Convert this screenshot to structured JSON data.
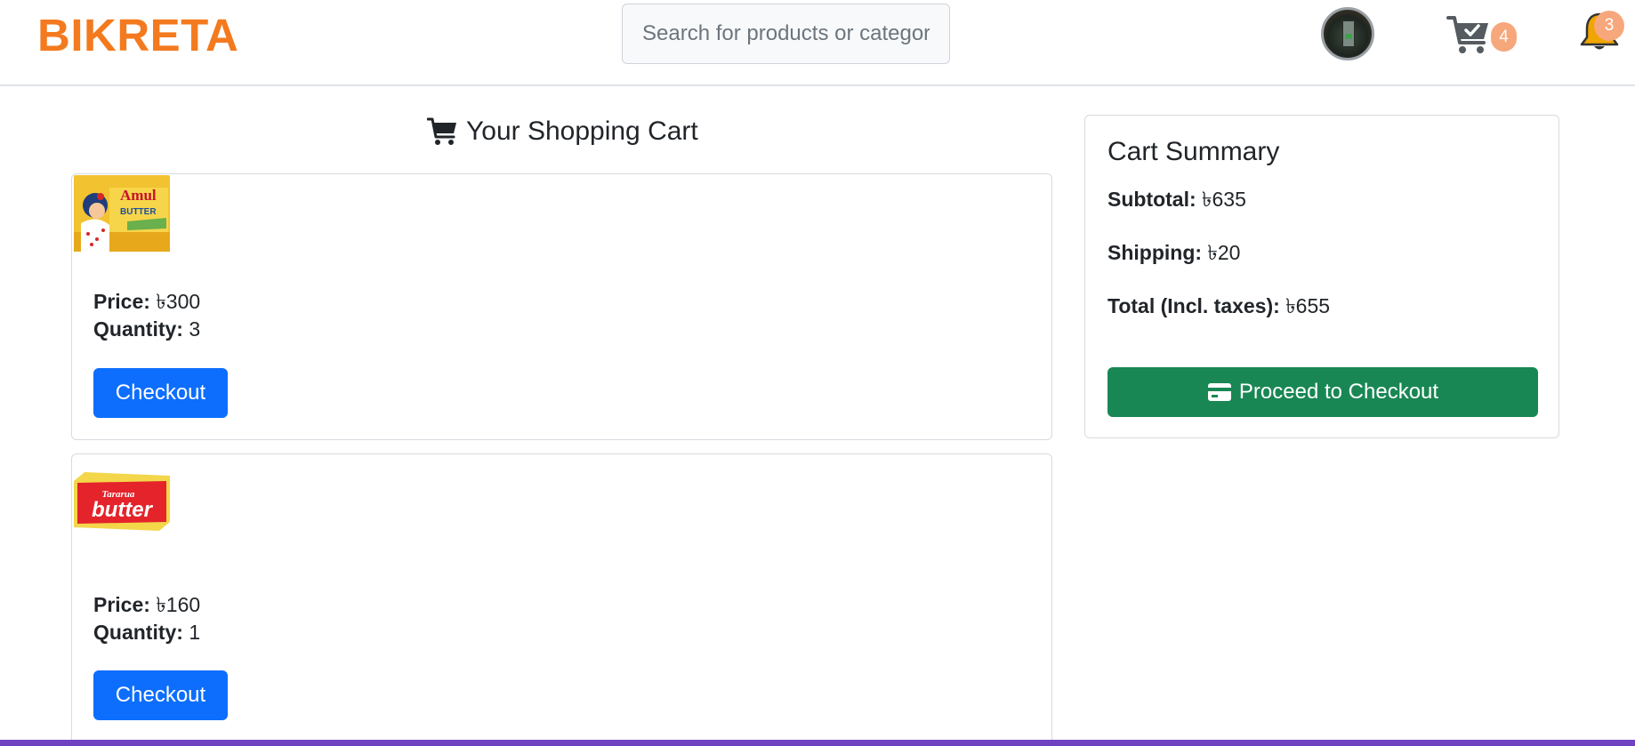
{
  "header": {
    "brand": "BIKRETA",
    "search_placeholder": "Search for products or categories",
    "cart_count": "4",
    "notification_count": "3",
    "icons": {
      "cart": "cart-check-icon",
      "bell": "bell-icon",
      "avatar": "user-avatar"
    }
  },
  "cart": {
    "title": "Your Shopping Cart",
    "items": [
      {
        "image": "amul-butter-product-image",
        "price_label": "Price:",
        "price": "৳300",
        "qty_label": "Quantity:",
        "qty": "3",
        "button": "Checkout"
      },
      {
        "image": "tararua-butter-product-image",
        "price_label": "Price:",
        "price": "৳160",
        "qty_label": "Quantity:",
        "qty": "1",
        "button": "Checkout"
      }
    ]
  },
  "summary": {
    "title": "Cart Summary",
    "subtotal_label": "Subtotal:",
    "subtotal": "৳635",
    "shipping_label": "Shipping:",
    "shipping": "৳20",
    "total_label": "Total (Incl. taxes):",
    "total": "৳655",
    "button": "Proceed to Checkout"
  },
  "colors": {
    "brand": "#f47a1f",
    "primary": "#0d6efd",
    "success": "#198754",
    "badge": "#f7a77c",
    "bottom_bar": "#6f42c1"
  }
}
